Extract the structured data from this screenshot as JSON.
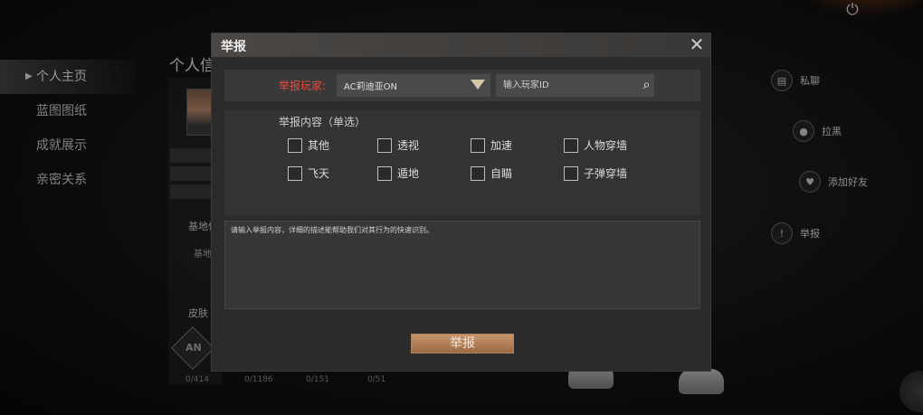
{
  "sidebar": {
    "items": [
      {
        "label": "个人主页",
        "active": true
      },
      {
        "label": "蓝图图纸",
        "active": false
      },
      {
        "label": "成就展示",
        "active": false
      },
      {
        "label": "亲密关系",
        "active": false
      }
    ]
  },
  "profile": {
    "title": "个人信",
    "section_base": "基地信",
    "section_base_sub": "基地",
    "section_skin": "皮肤",
    "stats": [
      "0/414",
      "0/1186",
      "0/151",
      "0/51"
    ]
  },
  "actions": {
    "private_chat": "私聊",
    "block": "拉黑",
    "add_friend": "添加好友",
    "report": "举报"
  },
  "modal": {
    "title": "举报",
    "player_label": "举报玩家:",
    "selected_player": "AC莉迪亚ON",
    "id_placeholder": "输入玩家ID",
    "content_label": "举报内容（单选）",
    "options_row1": [
      "其他",
      "透视",
      "加速",
      "人物穿墙"
    ],
    "options_row2": [
      "飞天",
      "遁地",
      "自瞄",
      "子弹穿墙"
    ],
    "text_placeholder": "请输入举报内容，详细的描述能帮助我们对其行为的快速识别。",
    "submit_label": "举报"
  },
  "icons": {
    "power": "power-icon",
    "close": "close-icon",
    "search": "search-icon",
    "chat": "chat-icon",
    "person": "person-icon",
    "heart": "heart-icon",
    "report": "report-icon"
  },
  "colors": {
    "player_label": "#e84c3d",
    "submit_button": "#b07d55",
    "dropdown_arrow": "#d6c6a8"
  }
}
